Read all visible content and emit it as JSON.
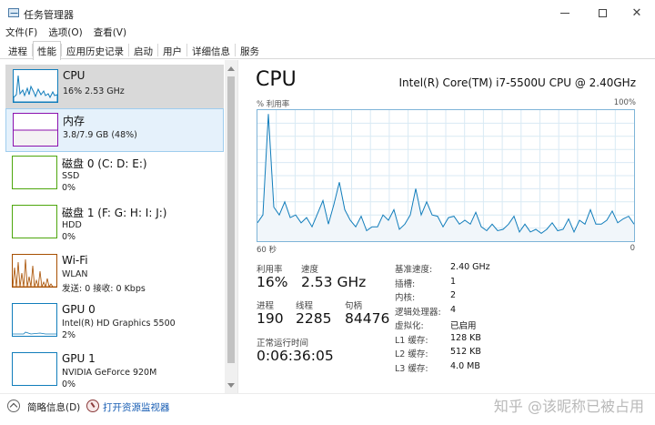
{
  "window": {
    "title": "任务管理器",
    "icon": "task-manager-icon"
  },
  "menu": [
    "文件(F)",
    "选项(O)",
    "查看(V)"
  ],
  "tabs": [
    "进程",
    "性能",
    "应用历史记录",
    "启动",
    "用户",
    "详细信息",
    "服务"
  ],
  "active_tab": "性能",
  "sidebar": {
    "items": [
      {
        "name": "CPU",
        "lines": [
          "16% 2.53 GHz"
        ],
        "thumb_color": "#117dbb",
        "state": "active"
      },
      {
        "name": "内存",
        "lines": [
          "3.8/7.9 GB (48%)"
        ],
        "thumb_color": "#8b12ae",
        "state": "selected"
      },
      {
        "name": "磁盘 0 (C: D: E:)",
        "lines": [
          "SSD",
          "0%"
        ],
        "thumb_color": "#4da60c",
        "state": "normal"
      },
      {
        "name": "磁盘 1 (F: G: H: I: J:)",
        "lines": [
          "HDD",
          "0%"
        ],
        "thumb_color": "#4da60c",
        "state": "normal"
      },
      {
        "name": "Wi-Fi",
        "lines": [
          "WLAN",
          "发送: 0 接收: 0 Kbps"
        ],
        "thumb_color": "#a74f01",
        "state": "normal"
      },
      {
        "name": "GPU 0",
        "lines": [
          "Intel(R) HD Graphics 5500",
          "2%"
        ],
        "thumb_color": "#117dbb",
        "state": "normal"
      },
      {
        "name": "GPU 1",
        "lines": [
          "NVIDIA GeForce 920M",
          "0%"
        ],
        "thumb_color": "#117dbb",
        "state": "normal"
      }
    ]
  },
  "cpu_panel": {
    "title": "CPU",
    "model": "Intel(R) Core(TM) i7-5500U CPU @ 2.40GHz",
    "graph_label": "% 利用率",
    "graph_max": "100%",
    "axis_left": "60 秒",
    "axis_right": "0",
    "graph_color": "#117dbb",
    "graph_fill": "#f1f6fa",
    "utilization_series": [
      14,
      20,
      97,
      26,
      20,
      30,
      18,
      20,
      14,
      18,
      11,
      21,
      31,
      13,
      28,
      45,
      24,
      16,
      11,
      19,
      8,
      11,
      11,
      20,
      16,
      24,
      9,
      13,
      20,
      40,
      20,
      30,
      20,
      19,
      11,
      18,
      19,
      13,
      16,
      13,
      22,
      11,
      8,
      13,
      8,
      9,
      13,
      19,
      7,
      13,
      7,
      9,
      6,
      9,
      14,
      8,
      9,
      17,
      7,
      16,
      13,
      24,
      13,
      13,
      16,
      23,
      14,
      17,
      19,
      13
    ],
    "stats": {
      "utilization": {
        "label": "利用率",
        "value": "16%"
      },
      "speed": {
        "label": "速度",
        "value": "2.53 GHz"
      },
      "processes": {
        "label": "进程",
        "value": "190"
      },
      "threads": {
        "label": "线程",
        "value": "2285"
      },
      "handles": {
        "label": "句柄",
        "value": "84476"
      },
      "uptime": {
        "label": "正常运行时间",
        "value": "0:06:36:05"
      }
    },
    "specs": [
      {
        "key": "基准速度:",
        "value": "2.40 GHz"
      },
      {
        "key": "插槽:",
        "value": "1"
      },
      {
        "key": "内核:",
        "value": "2"
      },
      {
        "key": "逻辑处理器:",
        "value": "4"
      },
      {
        "key": "虚拟化:",
        "value": "已启用"
      },
      {
        "key": "L1 缓存:",
        "value": "128 KB"
      },
      {
        "key": "L2 缓存:",
        "value": "512 KB"
      },
      {
        "key": "L3 缓存:",
        "value": "4.0 MB"
      }
    ]
  },
  "footer": {
    "fewer_details": "简略信息(D)",
    "open_monitor": "打开资源监视器",
    "watermark": "知乎 @该昵称已被占用"
  }
}
